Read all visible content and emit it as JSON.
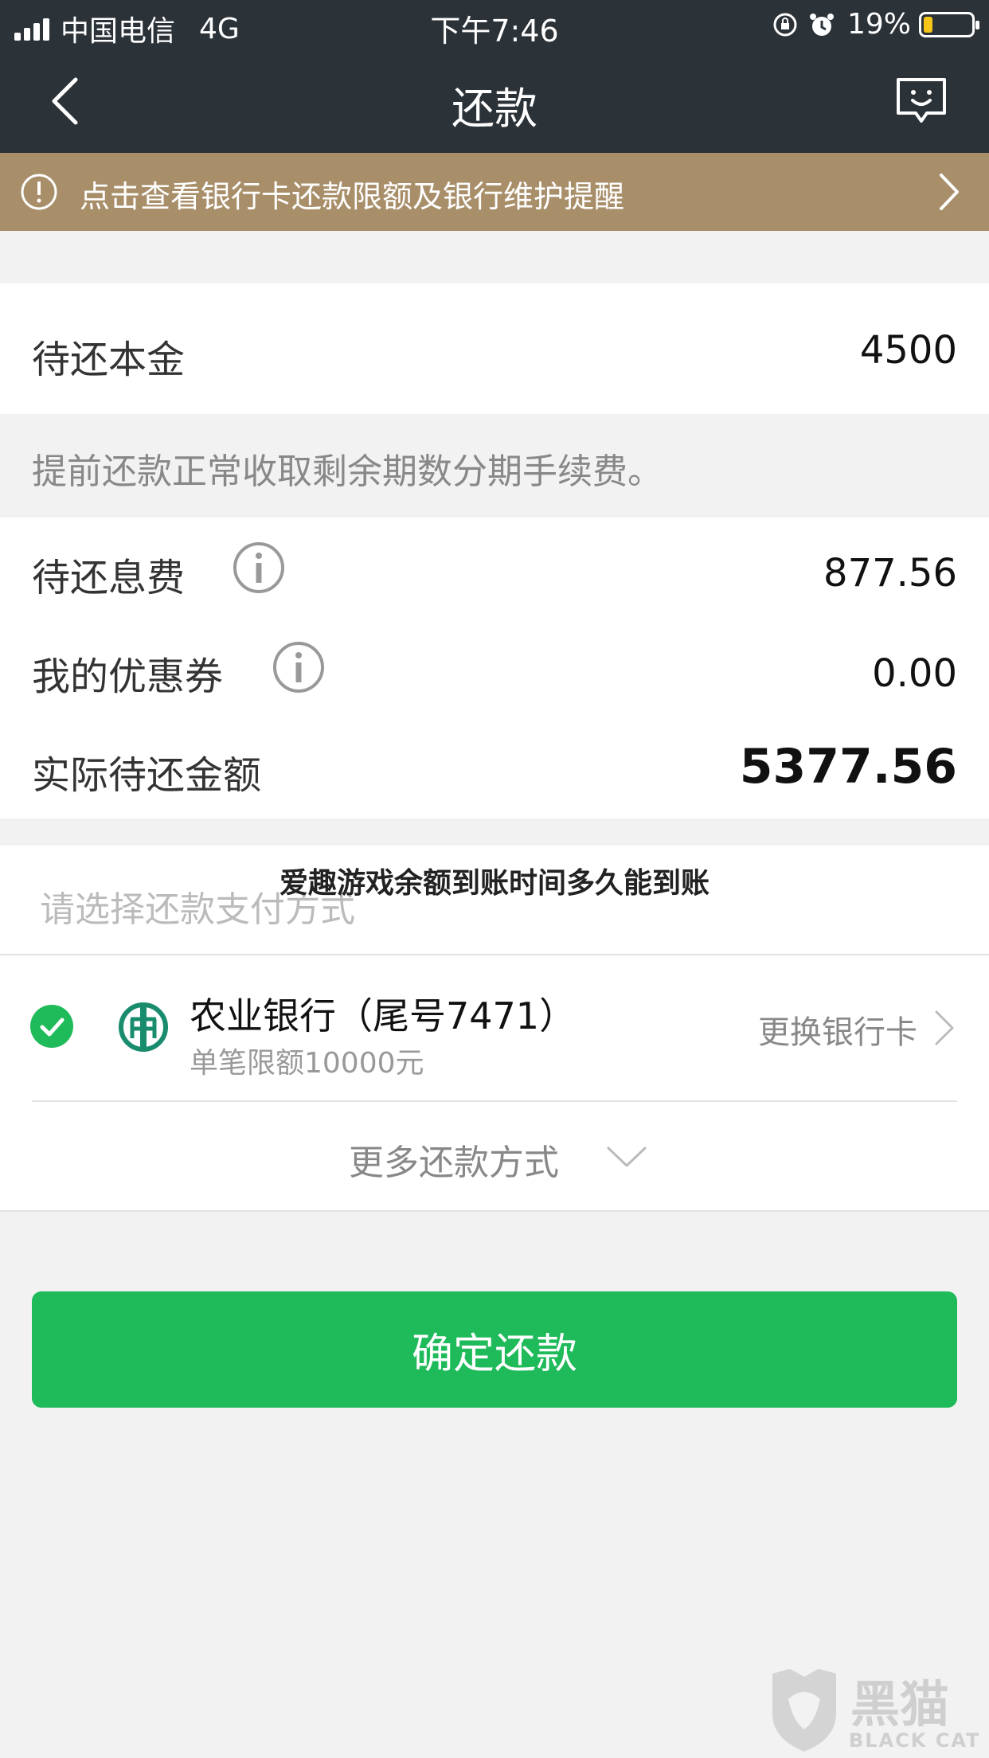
{
  "status_bar": {
    "carrier": "中国电信",
    "network": "4G",
    "time": "下午7:46",
    "battery": "19%",
    "battery_level": 0.19
  },
  "nav": {
    "title": "还款",
    "back_icon": "chevron-left-icon",
    "message_icon": "chat-smile-icon"
  },
  "notice": {
    "text": "点击查看银行卡还款限额及银行维护提醒",
    "icon": "exclamation-circle-icon",
    "color": "#a88f6a"
  },
  "principal": {
    "label": "待还本金",
    "value": "4500"
  },
  "tip": "提前还款正常收取剩余期数分期手续费。",
  "interest": {
    "label": "待还息费",
    "value": "877.56"
  },
  "coupon": {
    "label": "我的优惠券",
    "value": "0.00"
  },
  "total": {
    "label": "实际待还金额",
    "value": "5377.56"
  },
  "payment": {
    "section_label": "请选择还款支付方式",
    "bank_name": "农业银行（尾号7471）",
    "bank_limit": "单笔限额10000元",
    "change_card": "更换银行卡",
    "more_methods": "更多还款方式"
  },
  "overlay_title": "爱趣游戏余额到账时间多久能到账",
  "confirm_button": "确定还款",
  "watermark": {
    "brand_cn": "黑猫",
    "brand_en": "BLACK CAT"
  },
  "colors": {
    "header_bg": "#2b3238",
    "accent_green": "#1fba5a",
    "bank_green": "#1a8c6e"
  }
}
